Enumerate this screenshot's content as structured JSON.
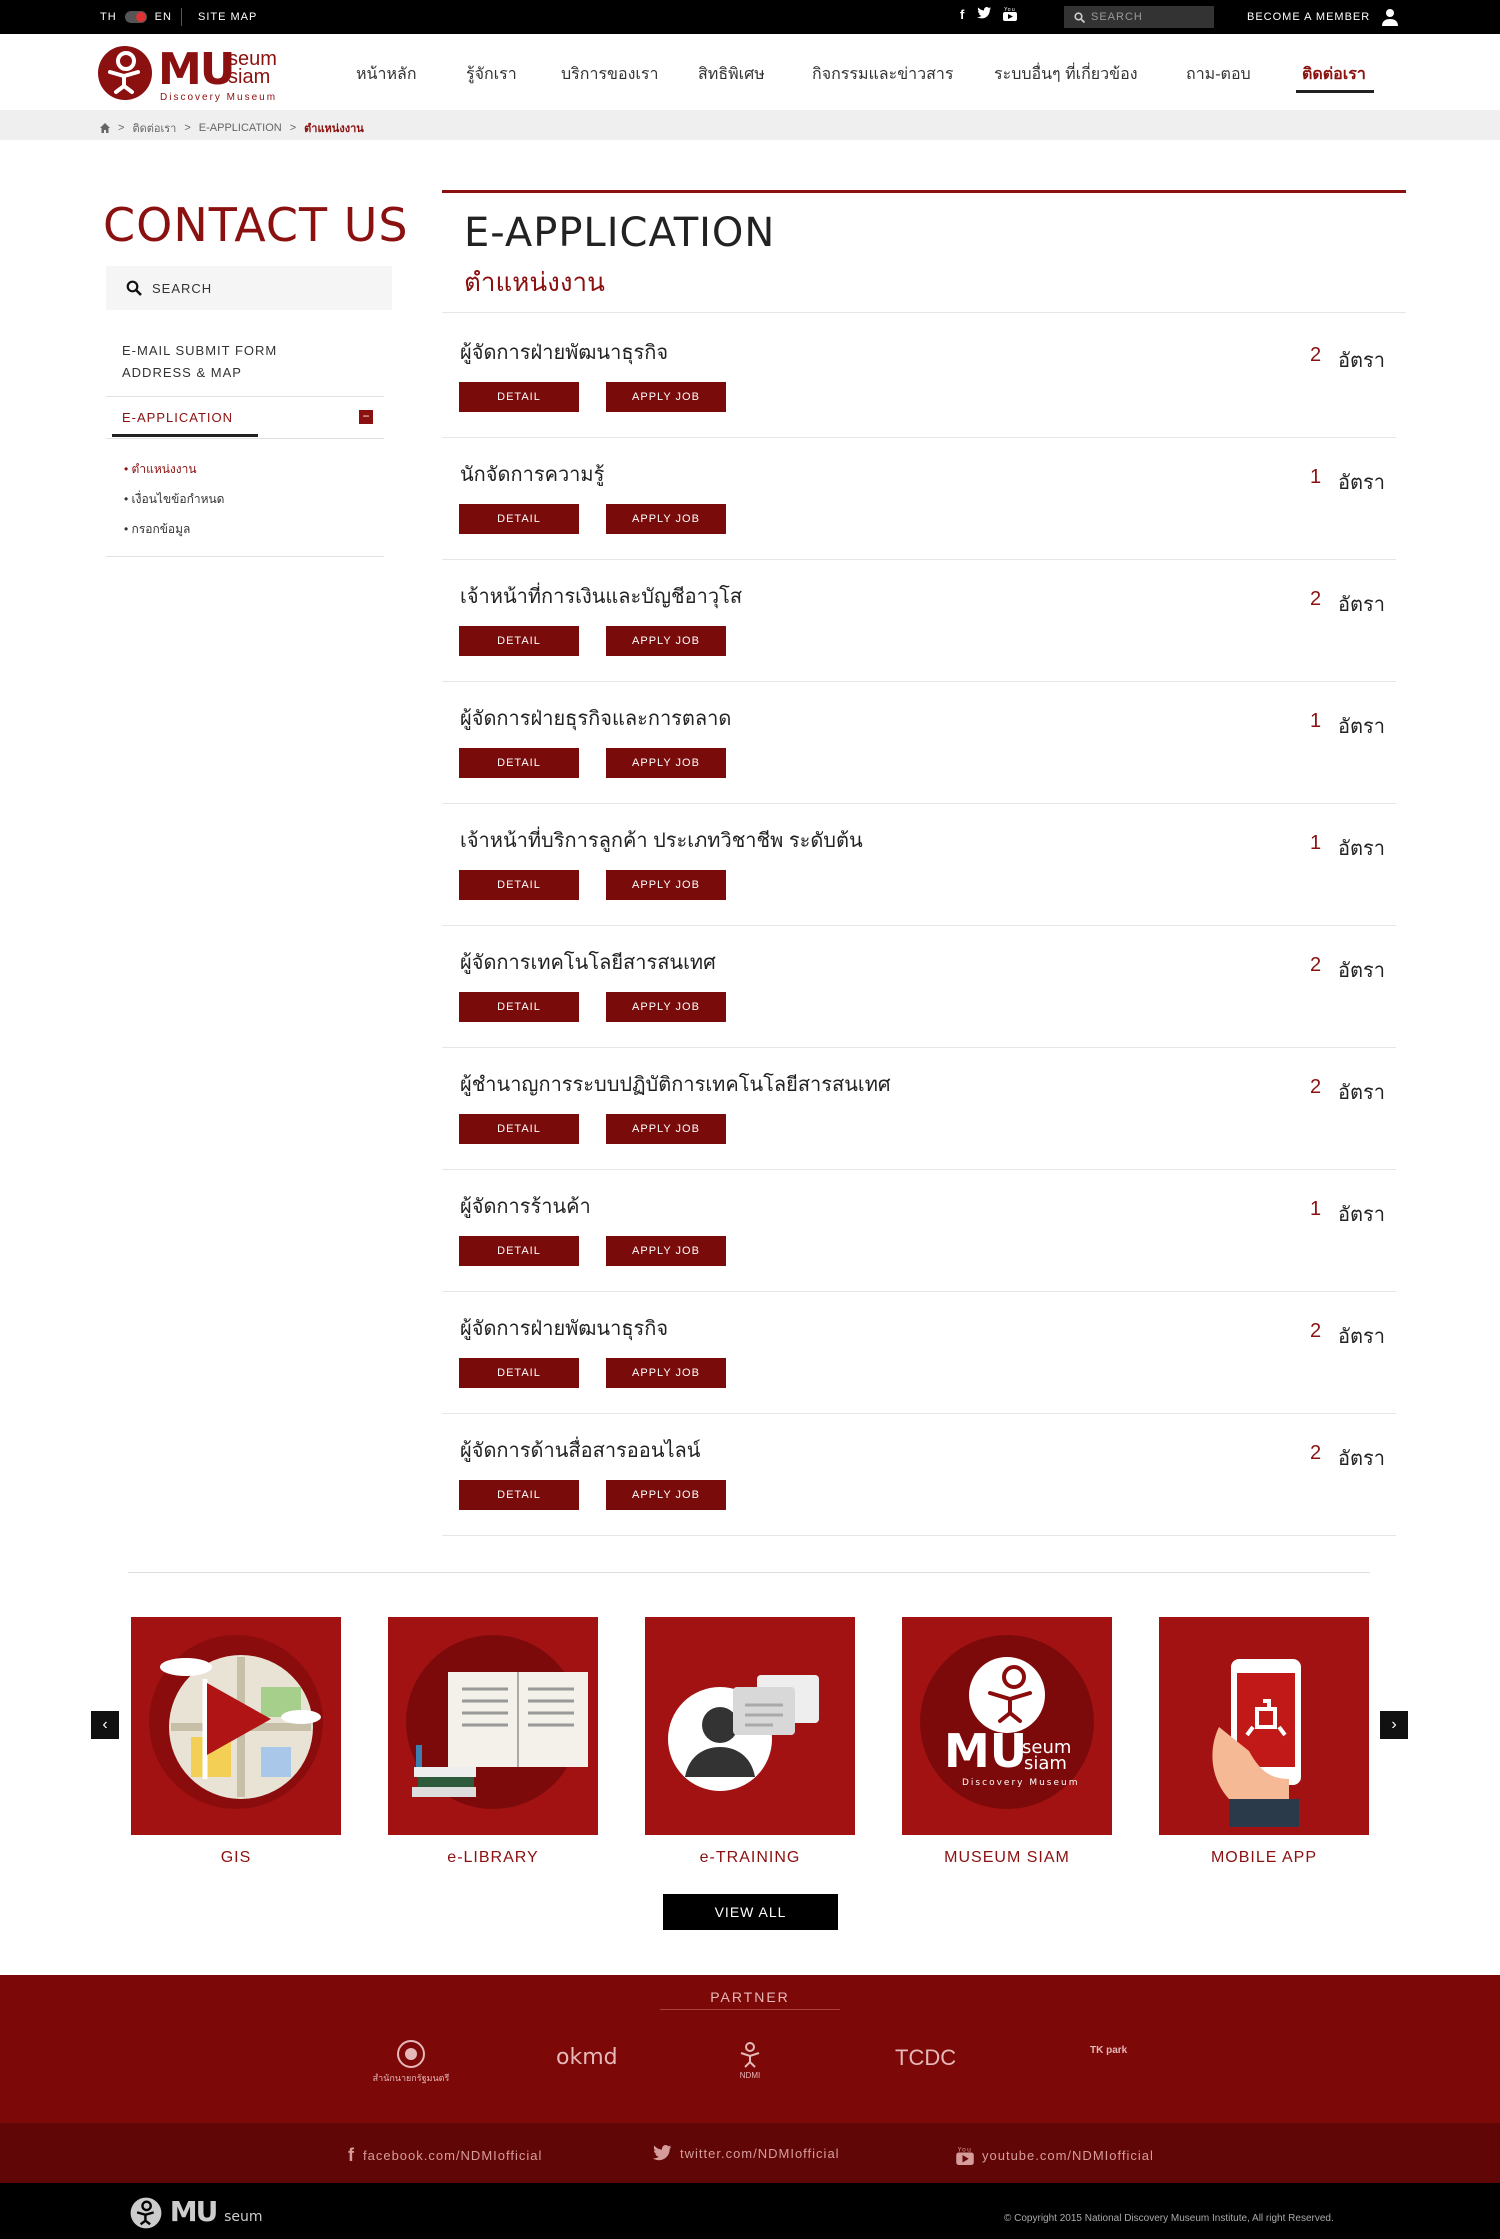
{
  "topbar": {
    "lang_th": "TH",
    "lang_en": "EN",
    "sitemap": "SITE MAP",
    "search_placeholder": "SEARCH",
    "member": "BECOME A MEMBER",
    "social_icons": [
      "facebook-icon",
      "twitter-icon",
      "youtube-icon"
    ]
  },
  "header": {
    "logo_mu": "MU",
    "logo_seum": "seum",
    "logo_siam": "siam",
    "logo_sub": "Discovery Museum",
    "nav": [
      "หน้าหลัก",
      "รู้จักเรา",
      "บริการของเรา",
      "สิทธิพิเศษ",
      "กิจกรรมและข่าวสาร",
      "ระบบอื่นๆ ที่เกี่ยวข้อง",
      "ถาม-ตอบ",
      "ติดต่อเรา"
    ],
    "active_nav": "ติดต่อเรา"
  },
  "breadcrumb": {
    "items": [
      "ติดต่อเรา",
      "E-APPLICATION"
    ],
    "current": "ตำแหน่งงาน"
  },
  "sidebar": {
    "title": "CONTACT US",
    "search_label": "SEARCH",
    "links": [
      "E-MAIL SUBMIT FORM",
      "ADDRESS & MAP"
    ],
    "active": "E-APPLICATION",
    "sub_items": [
      "ตำแหน่งงาน",
      "เงื่อนไขข้อกำหนด",
      "กรอกข้อมูล"
    ]
  },
  "main": {
    "title": "E-APPLICATION",
    "subtitle": "ตำแหน่งงาน",
    "detail_label": "DETAIL",
    "apply_label": "APPLY JOB",
    "unit": "อัตรา",
    "jobs": [
      {
        "title": "ผู้จัดการฝ่ายพัฒนาธุรกิจ",
        "count": "2"
      },
      {
        "title": "นักจัดการความรู้",
        "count": "1"
      },
      {
        "title": "เจ้าหน้าที่การเงินและบัญชีอาวุโส",
        "count": "2"
      },
      {
        "title": "ผู้จัดการฝ่ายธุรกิจและการตลาด",
        "count": "1"
      },
      {
        "title": "เจ้าหน้าที่บริการลูกค้า ประเภทวิชาชีพ ระดับต้น",
        "count": "1"
      },
      {
        "title": "ผู้จัดการเทคโนโลยีสารสนเทศ",
        "count": "2"
      },
      {
        "title": "ผู้ชำนาญการระบบปฏิบัติการเทคโนโลยีสารสนเทศ",
        "count": "2"
      },
      {
        "title": "ผู้จัดการร้านค้า",
        "count": "1"
      },
      {
        "title": "ผู้จัดการฝ่ายพัฒนาธุรกิจ",
        "count": "2"
      },
      {
        "title": "ผู้จัดการด้านสื่อสารออนไลน์",
        "count": "2"
      }
    ]
  },
  "services": {
    "cards": [
      "GIS",
      "e-LIBRARY",
      "e-TRAINING",
      "MUSEUM SIAM",
      "MOBILE APP"
    ],
    "view_all": "VIEW ALL"
  },
  "footer": {
    "partner_title": "PARTNER",
    "partners": [
      "สำนักนายกรัฐมนตรี",
      "okmd",
      "NDMI",
      "TCDC",
      "TK park"
    ],
    "facebook": "facebook.com/NDMIofficial",
    "twitter": "twitter.com/NDMIofficial",
    "youtube": "youtube.com/NDMIofficial",
    "copyright": "© Copyright 2015 National Discovery Museum Institute, All right Reserved."
  },
  "colors": {
    "brand": "#8b1010",
    "button": "#7a0b0b",
    "card": "#a31212",
    "footer": "#7c0808"
  }
}
